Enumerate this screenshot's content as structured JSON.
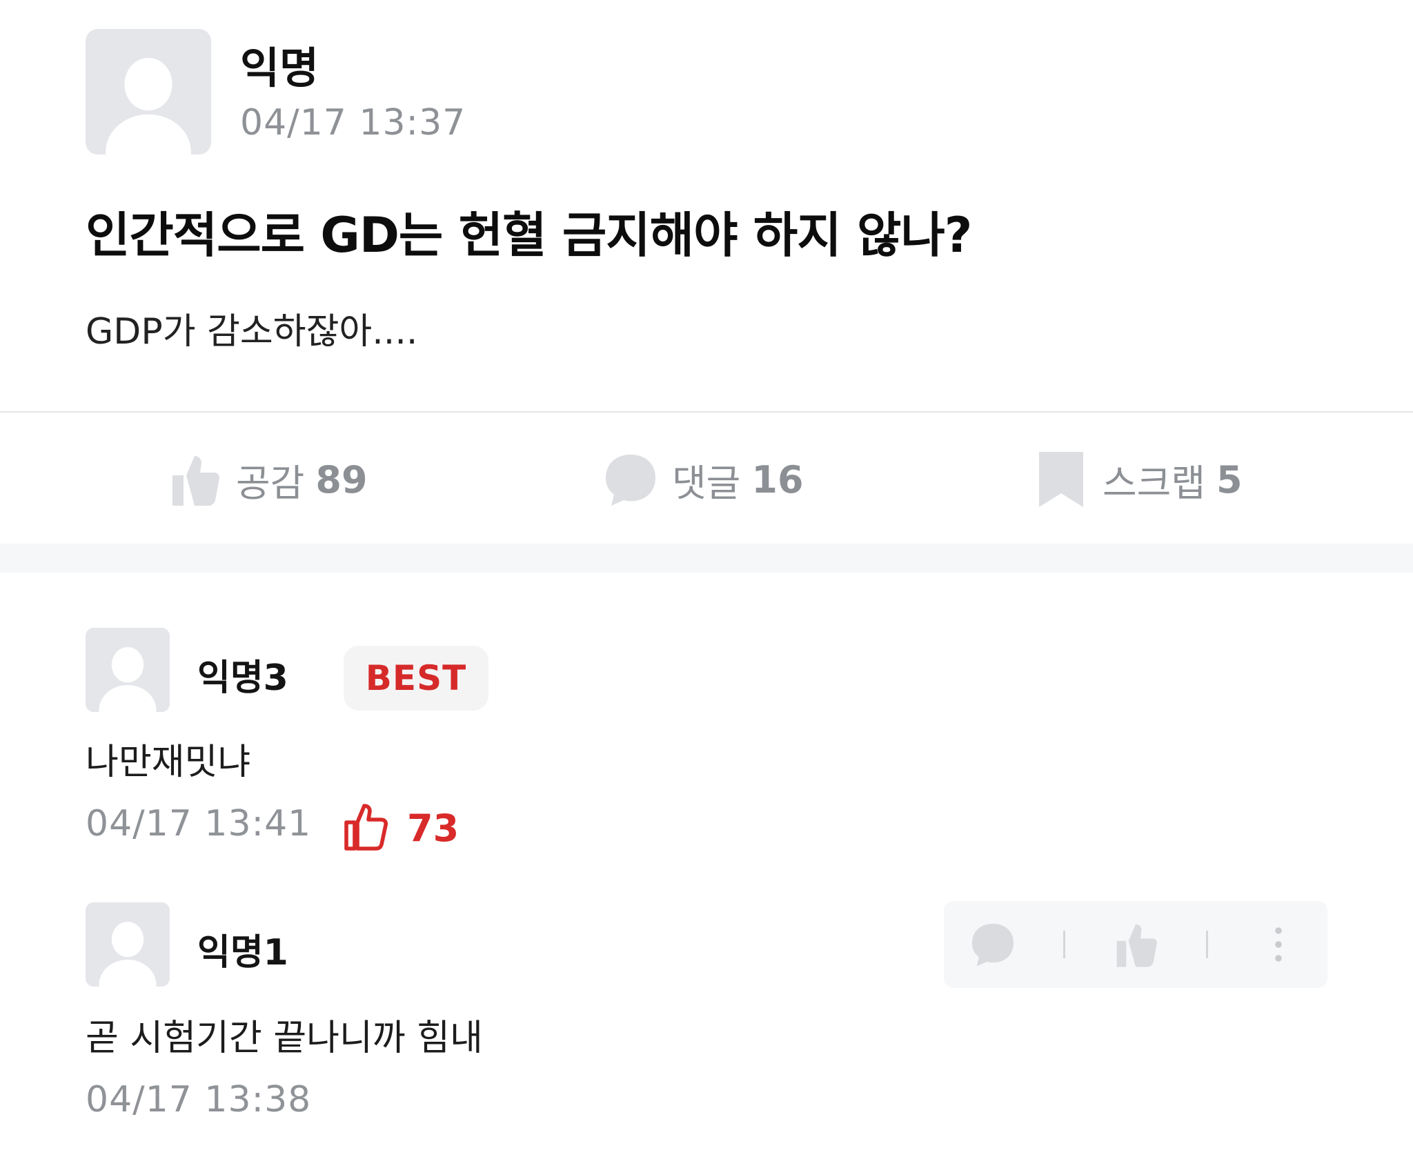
{
  "post": {
    "author": "익명",
    "time": "04/17 13:37",
    "title": "인간적으로 GD는 헌혈 금지해야 하지 않나?",
    "body": "GDP가 감소하잖아...."
  },
  "actions": {
    "like": {
      "label": "공감",
      "count": "89"
    },
    "comment": {
      "label": "댓글",
      "count": "16"
    },
    "scrap": {
      "label": "스크랩",
      "count": "5"
    }
  },
  "comments": [
    {
      "author": "익명3",
      "badge": "BEST",
      "text": "나만재밋냐",
      "time": "04/17 13:41",
      "likes": "73"
    },
    {
      "author": "익명1",
      "text": "곧 시험기간 끝나니까 힘내",
      "time": "04/17 13:38"
    }
  ],
  "colors": {
    "accent_red": "#d62a2a",
    "muted_text": "#8e9196",
    "icon_gray": "#d9dbde"
  },
  "icons": {
    "like": "thumbs-up-icon",
    "comment": "speech-bubble-icon",
    "scrap": "bookmark-icon",
    "more": "more-vertical-icon"
  }
}
